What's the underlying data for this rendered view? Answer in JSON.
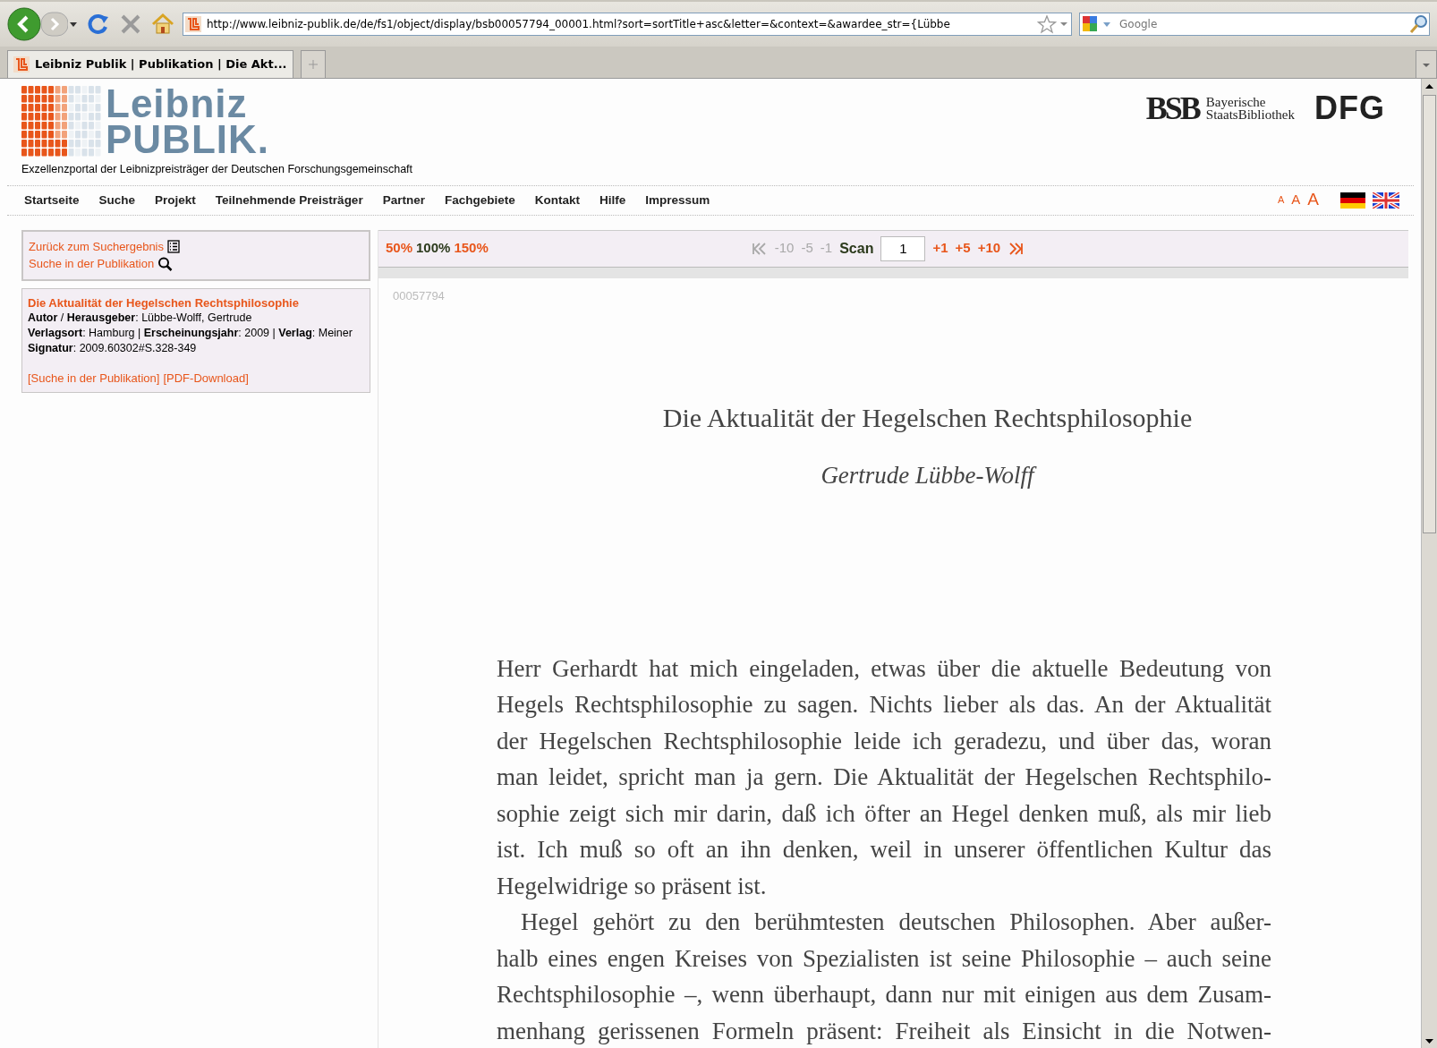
{
  "browser": {
    "url": "http://www.leibniz-publik.de/de/fs1/object/display/bsb00057794_00001.html?sort=sortTitle+asc&letter=&context=&awardee_str={Lübbe",
    "search_placeholder": "Google",
    "tabs": [
      {
        "title": "Leibniz Publik | Publikation | Die Akt...",
        "selected": true
      }
    ]
  },
  "header": {
    "logo_top": "Leibniz",
    "logo_bottom": "PUBLIK.",
    "tagline": "Exzellenzportal der Leibnizpreisträger der Deutschen Forschungsgemeinschaft",
    "bsb": "BSB",
    "bsb_name": [
      "Bayerische",
      "StaatsBibliothek"
    ],
    "dfg": "DFG"
  },
  "nav": [
    "Startseite",
    "Suche",
    "Projekt",
    "Teilnehmende Preisträger",
    "Partner",
    "Fachgebiete",
    "Kontakt",
    "Hilfe",
    "Impressum"
  ],
  "font_sizes": [
    "A",
    "A",
    "A"
  ],
  "sidebar": {
    "links": [
      {
        "label": "Zurück zum Suchergebnis",
        "kind": "list"
      },
      {
        "label": "Suche in der Publikation",
        "kind": "search"
      }
    ],
    "record": {
      "title": "Die Aktualität der Hegelschen Rechtsphilosophie",
      "fields": [
        "**Autor** / **Herausgeber**: Lübbe-Wolff, Gertrude",
        "**Verlagsort**: Hamburg | **Erscheinungsjahr**: 2009 | **Verlag**: Meiner",
        "**Signatur**: 2009.60302#S.328-349"
      ],
      "links": [
        "[Suche in der Publikation]",
        "[PDF-Download]"
      ]
    }
  },
  "viewer": {
    "zoom": [
      {
        "label": "50%",
        "selected": false
      },
      {
        "label": "100%",
        "selected": true
      },
      {
        "label": "150%",
        "selected": false
      }
    ],
    "pager_back": [
      {
        "kind": "first",
        "disabled": true
      },
      {
        "kind": "step",
        "label": "-10",
        "disabled": true
      },
      {
        "kind": "step",
        "label": "-5",
        "disabled": true
      },
      {
        "kind": "step",
        "label": "-1",
        "disabled": true
      }
    ],
    "scan_label": "Scan",
    "scan_value": "1",
    "pager_forward": [
      {
        "kind": "step",
        "label": "+1",
        "disabled": false
      },
      {
        "kind": "step",
        "label": "+5",
        "disabled": false
      },
      {
        "kind": "step",
        "label": "+10",
        "disabled": false
      },
      {
        "kind": "last",
        "disabled": false
      }
    ],
    "page_id": "00057794",
    "document": {
      "title": "Die Aktualität der Hegelschen Rechtsphilosophie",
      "author": "Gertrude Lübbe-Wolff",
      "paragraphs": [
        {
          "indent": false,
          "continues": false,
          "lines": [
            "Herr Gerhardt hat mich eingeladen, etwas über die aktuelle Bedeutung von",
            "Hegels Rechtsphilosophie zu sagen. Nichts lieber als das. An der Aktualität",
            "der Hegelschen Rechtsphilosophie leide ich geradezu, und über das, woran",
            "man leidet, spricht man ja gern. Die Aktualität der Hegelschen Rechtsphilo-",
            "sophie zeigt sich mir darin, daß ich öfter an Hegel denken muß, als mir lieb",
            "ist. Ich muß so oft an ihn denken, weil in unserer öffentlichen Kultur das",
            "Hegelwidrige so präsent ist."
          ]
        },
        {
          "indent": true,
          "continues": true,
          "lines": [
            "Hegel gehört zu den berühmtesten deutschen Philosophen. Aber außer-",
            "halb eines engen Kreises von Spezialisten ist seine Philosophie – auch seine",
            "Rechtsphilosophie –, wenn überhaupt, dann nur mit einigen aus dem Zusam-",
            "menhang gerissenen Formeln präsent: Freiheit als Einsicht in die Notwen-"
          ]
        }
      ]
    }
  }
}
